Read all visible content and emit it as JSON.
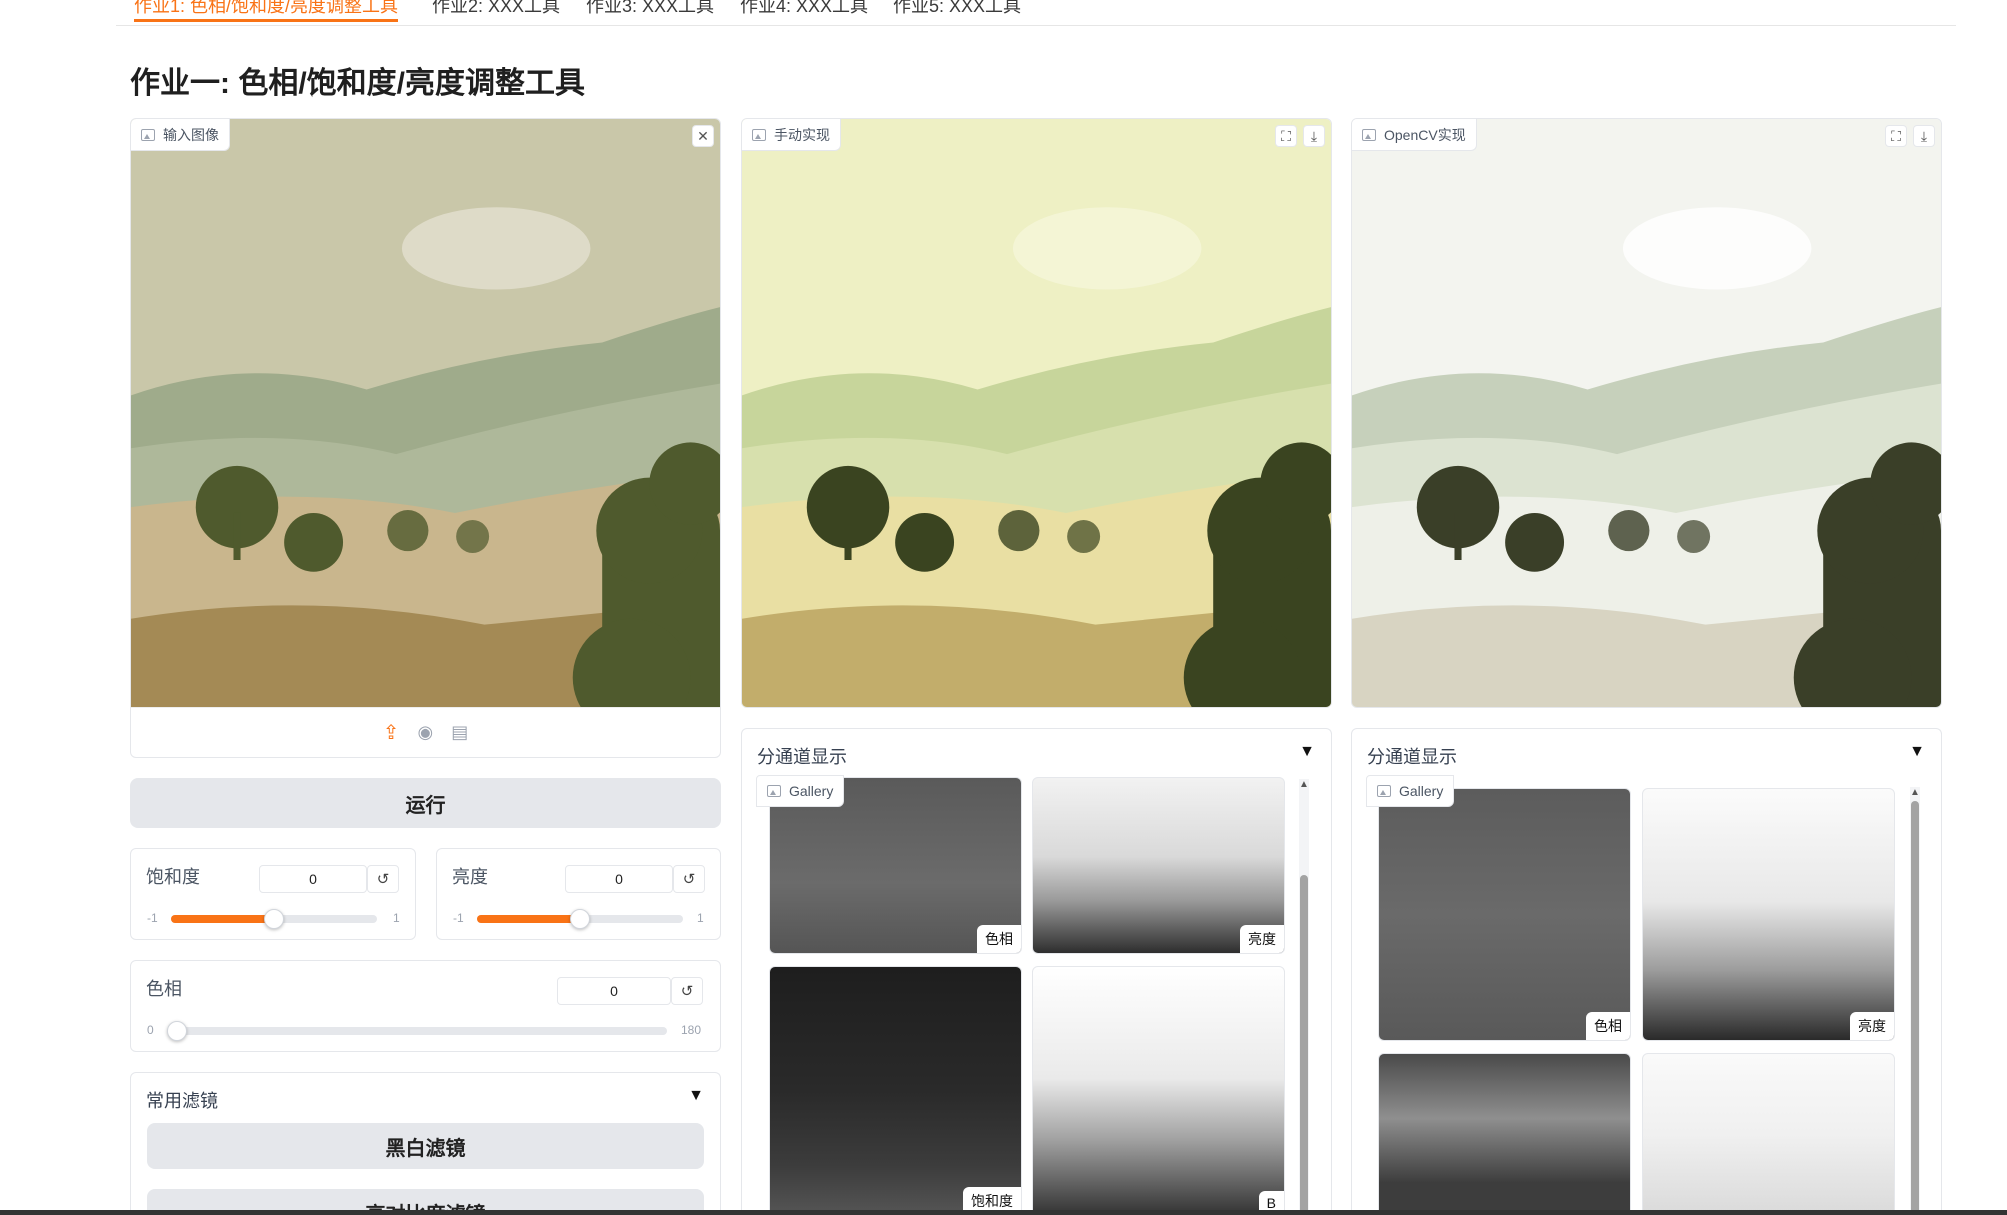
{
  "tabs": [
    {
      "label": "作业1: 色相/饱和度/亮度调整工具",
      "active": true
    },
    {
      "label": "作业2: XXX工具",
      "active": false
    },
    {
      "label": "作业3: XXX工具",
      "active": false
    },
    {
      "label": "作业4: XXX工具",
      "active": false
    },
    {
      "label": "作业5: XXX工具",
      "active": false
    }
  ],
  "page_title": "作业一: 色相/饱和度/亮度调整工具",
  "input_panel": {
    "label": "输入图像",
    "close_icon": "close-icon",
    "upload_icons": [
      "upload-icon",
      "webcam-icon",
      "clipboard-icon"
    ]
  },
  "manual_panel": {
    "label": "手动实现"
  },
  "opencv_panel": {
    "label": "OpenCV实现"
  },
  "run_button": "运行",
  "saturation": {
    "label": "饱和度",
    "value": "0",
    "min": "-1",
    "max": "1",
    "level": 0.5
  },
  "brightness": {
    "label": "亮度",
    "value": "0",
    "min": "-1",
    "max": "1",
    "level": 0.5
  },
  "hue": {
    "label": "色相",
    "value": "0",
    "min": "0",
    "max": "180",
    "level": 0
  },
  "filters": {
    "title": "常用滤镜",
    "buttons": [
      "黑白滤镜",
      "高对比度滤镜"
    ]
  },
  "channels_manual": {
    "title": "分通道显示",
    "gallery_label": "Gallery",
    "captions": [
      "色相",
      "亮度",
      "饱和度",
      "B"
    ]
  },
  "channels_opencv": {
    "title": "分通道显示",
    "gallery_label": "Gallery",
    "captions": [
      "色相",
      "亮度"
    ]
  },
  "colors": {
    "accent": "#f97316",
    "border": "#e5e7eb",
    "button_bg": "#e5e7eb"
  }
}
